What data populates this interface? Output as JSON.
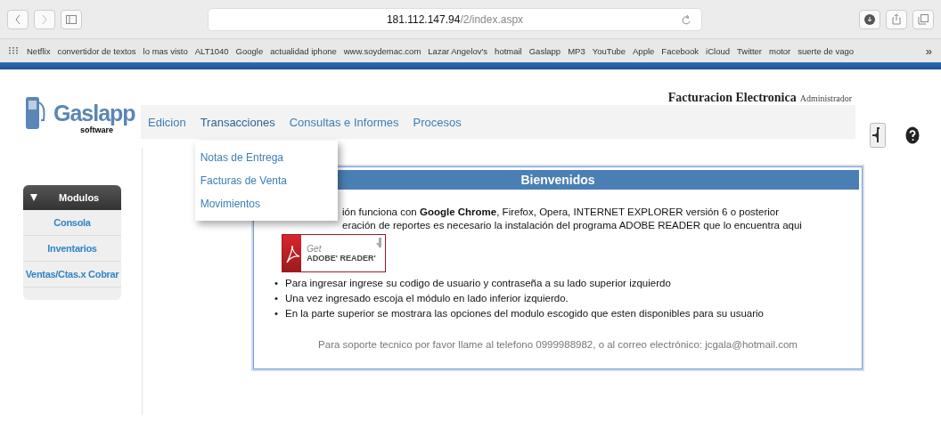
{
  "browser": {
    "url_host": "181.112.147.94",
    "url_path": "/2/index.aspx",
    "bookmarks": [
      "Netflix",
      "convertidor de textos",
      "lo mas visto",
      "ALT1040",
      "Google",
      "actualidad iphone",
      "www.soydemac.com",
      "Lazar Angelov's",
      "hotmail",
      "Gaslapp",
      "MP3",
      "YouTube",
      "Apple",
      "Facebook",
      "iCloud",
      "Twitter",
      "motor",
      "suerte de vago"
    ],
    "overflow": "»"
  },
  "logo": {
    "name": "Gaslapp",
    "tagline": "software"
  },
  "header": {
    "title": "Facturacion Electronica",
    "role": "Administrador"
  },
  "menu": [
    {
      "label": "Edicion",
      "expanded": false
    },
    {
      "label": "Transacciones",
      "expanded": true,
      "children": [
        "Notas de Entrega",
        "Facturas de Venta",
        "Movimientos"
      ]
    },
    {
      "label": "Consultas e Informes",
      "expanded": false
    },
    {
      "label": "Procesos",
      "expanded": false
    }
  ],
  "sidebar": {
    "title": "Modulos",
    "expanded": true,
    "items": [
      "Consola",
      "Inventarios",
      "Ventas/Ctas.x Cobrar"
    ]
  },
  "welcome": {
    "title": "Bienvenidos",
    "partial_lines": [
      "ión funciona con **Google Chrome**, Firefox, Opera, INTERNET EXPLORER versión 6 o posterior",
      "eración de reportes es necesario la instalación del programa ADOBE READER que lo encuentra aqui"
    ],
    "adobe_badge": {
      "get": "Get",
      "product": "ADOBE' READER'"
    },
    "bullet": "•",
    "bullets": [
      "Para ingresar ingrese su codigo de usuario y contraseña a su lado superior izquierdo",
      "Una vez ingresado escoja el módulo en lado inferior izquierdo.",
      "En la parte superior se mostrara las opciones del modulo escogido que esten disponibles para su usuario"
    ],
    "support": "Para soporte tecnico por favor llame al telefono 0999988982, o al correo electrónico: jcgala@hotmail.com"
  }
}
